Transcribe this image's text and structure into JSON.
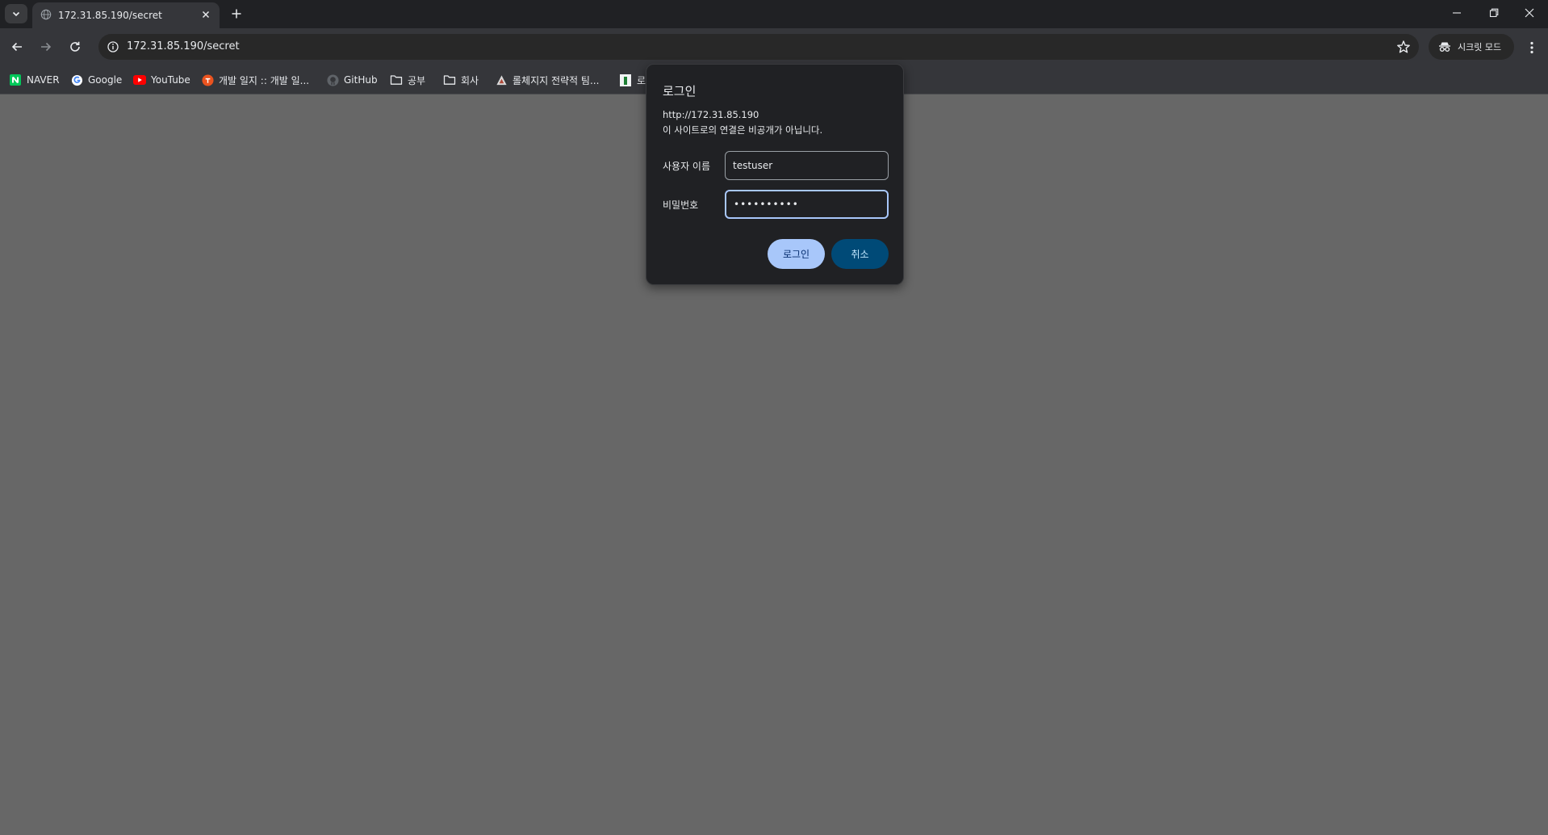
{
  "tab": {
    "title": "172.31.85.190/secret"
  },
  "address_bar": {
    "url": "172.31.85.190/secret"
  },
  "incognito": {
    "label": "시크릿 모드"
  },
  "bookmarks": [
    {
      "label": "NAVER",
      "icon": "naver-icon"
    },
    {
      "label": "Google",
      "icon": "google-icon"
    },
    {
      "label": "YouTube",
      "icon": "youtube-icon"
    },
    {
      "label": "개발 일지 :: 개발 일...",
      "icon": "tistory-icon"
    },
    {
      "label": "GitHub",
      "icon": "github-icon"
    },
    {
      "label": "공부",
      "icon": "folder-icon"
    },
    {
      "label": "회사",
      "icon": "folder-icon"
    },
    {
      "label": "롤체지지 전략적 팀...",
      "icon": "lolchess-icon"
    },
    {
      "label": "로",
      "icon": "bookmark-icon"
    }
  ],
  "dialog": {
    "title": "로그인",
    "host": "http://172.31.85.190",
    "warning": "이 사이트로의 연결은 비공개가 아닙니다.",
    "username_label": "사용자 이름",
    "username_value": "testuser",
    "password_label": "비밀번호",
    "password_value": "••••••••••",
    "login_button": "로그인",
    "cancel_button": "취소"
  },
  "colors": {
    "page_background": "#676767",
    "dialog_background": "#202124",
    "primary_button": "#a8c7fa",
    "secondary_button": "#004a77"
  }
}
